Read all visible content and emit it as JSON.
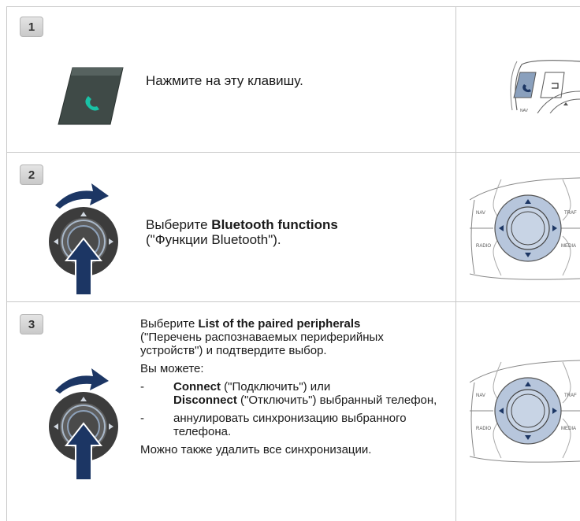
{
  "steps": [
    {
      "number": "1",
      "text": "Нажмите на эту клавишу."
    },
    {
      "number": "2",
      "line1_pre": "Выберите ",
      "line1_bold": "Bluetooth functions",
      "line2": "(\"Функции Bluetooth\")."
    },
    {
      "number": "3",
      "p1_pre": "Выберите ",
      "p1_bold": "List of the paired peripherals",
      "p1_rest": "(\"Перечень распознаваемых периферийных устройств\") и подтвердите выбор.",
      "p2": "Вы можете:",
      "item1": {
        "dash": "-",
        "bold1": "Connect",
        "mid": " (\"Подключить\") или",
        "bold2": "Disconnect",
        "rest": " (\"Отключить\") выбранный телефон,"
      },
      "item2": {
        "dash": "-",
        "text": "аннулировать синхронизацию выбранного телефона."
      },
      "p3": "Можно также удалить все синхронизации."
    }
  ],
  "panel_labels": {
    "nav": "NAV",
    "traf": "TRAF",
    "radio": "RADIO",
    "media": "MEDIA"
  },
  "colors": {
    "phone_key": "#3f4a47",
    "phone_glyph": "#19c2a6",
    "arrow": "#1c3664",
    "knob": "#3c3c3c",
    "knob_blue": "#7f9fc6",
    "panel_knob": "#b7c6dc"
  }
}
